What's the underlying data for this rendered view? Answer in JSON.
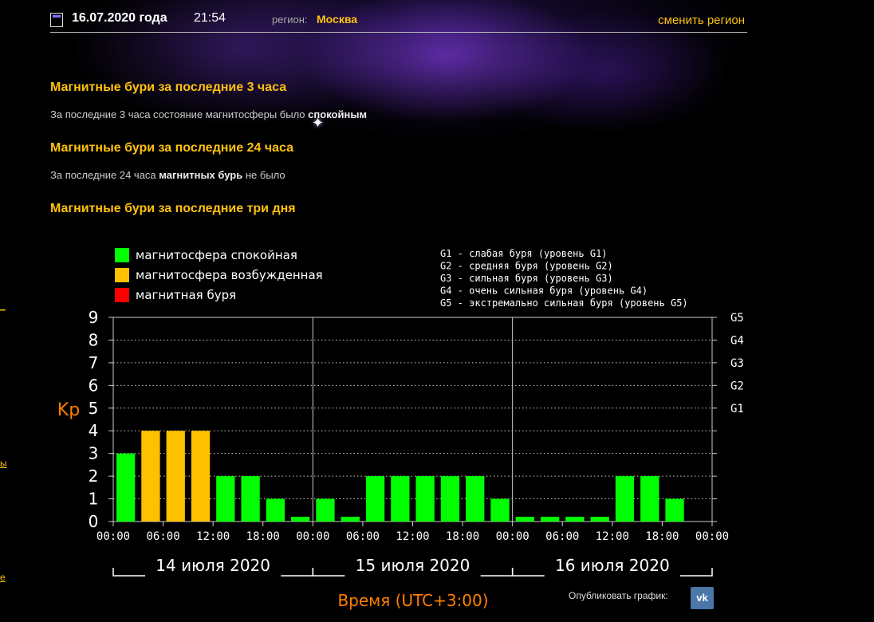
{
  "header": {
    "date": "16.07.2020 года",
    "time": "21:54",
    "region_label": "регион:",
    "region_value": "Москва",
    "change_region": "сменить регион"
  },
  "sections": {
    "s3h_title": "Магнитные бури за последние 3 часа",
    "s3h_text": "За последние 3 часа состояние магнитосферы было",
    "s3h_bold": "спокойным",
    "s24h_title": "Магнитные бури за последние 24 часа",
    "s24h_text_pre": "За последние 24 часа",
    "s24h_bold": "магнитных бурь",
    "s24h_text_post": "не было",
    "s3d_title": "Магнитные бури за последние три дня"
  },
  "legend": {
    "calm": "магнитосфера спокойная",
    "excited": "магнитосфера возбужденная",
    "storm": "магнитная буря"
  },
  "storm_levels": [
    "G1 - слабая буря (уровень G1)",
    "G2 - средняя буря (уровень G2)",
    "G3 - сильная буря (уровень G3)",
    "G4 - очень сильная буря (уровень G4)",
    "G5 - экстремально сильная буря (уровень G5)"
  ],
  "publish": {
    "label": "Опубликовать график:",
    "vk": "vk"
  },
  "colors": {
    "calm": "#00ff00",
    "excited": "#ffc000",
    "storm": "#ff0000",
    "accent": "#ffc20e",
    "axis_label": "#ff7f00"
  },
  "chart_data": {
    "type": "bar",
    "ylabel": "Kp",
    "xlabel": "Время (UTC+3:00)",
    "ylim": [
      0,
      9
    ],
    "yticks": [
      0,
      1,
      2,
      3,
      4,
      5,
      6,
      7,
      8,
      9
    ],
    "g_levels": [
      {
        "label": "G1",
        "kp": 5
      },
      {
        "label": "G2",
        "kp": 6
      },
      {
        "label": "G3",
        "kp": 7
      },
      {
        "label": "G4",
        "kp": 8
      },
      {
        "label": "G5",
        "kp": 9
      }
    ],
    "days": [
      {
        "label": "14 июля 2020",
        "values": [
          3,
          4,
          4,
          4,
          2,
          2,
          1,
          0
        ],
        "states": [
          "calm",
          "excited",
          "excited",
          "excited",
          "calm",
          "calm",
          "calm",
          "calm"
        ]
      },
      {
        "label": "15 июля 2020",
        "values": [
          1,
          0,
          2,
          2,
          2,
          2,
          2,
          1
        ],
        "states": [
          "calm",
          "calm",
          "calm",
          "calm",
          "calm",
          "calm",
          "calm",
          "calm"
        ]
      },
      {
        "label": "16 июля 2020",
        "values": [
          0,
          0,
          0,
          0,
          2,
          2,
          1,
          null
        ],
        "states": [
          "calm",
          "calm",
          "calm",
          "calm",
          "calm",
          "calm",
          "calm",
          null
        ]
      }
    ],
    "time_ticks": [
      "00:00",
      "06:00",
      "12:00",
      "18:00"
    ],
    "grid": "dotted horizontal"
  }
}
